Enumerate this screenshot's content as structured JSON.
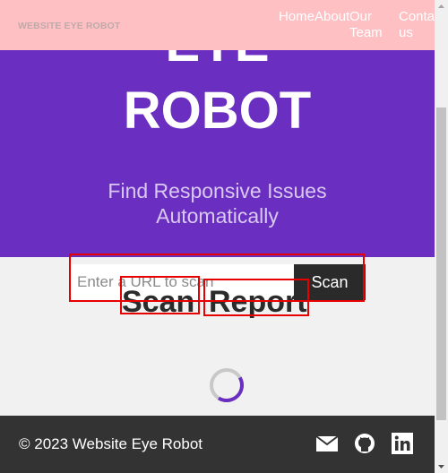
{
  "navbar": {
    "brand": "WEBSITE EYE ROBOT",
    "links": [
      {
        "label": "Home"
      },
      {
        "label": "About"
      },
      {
        "label": "Our Team"
      },
      {
        "label": "Contact us"
      }
    ]
  },
  "hero": {
    "title_line1": "EYE",
    "title_line2": "ROBOT",
    "subtitle": "Find Responsive Issues Automatically"
  },
  "scan": {
    "placeholder": "Enter a URL to scan",
    "button_label": "Scan"
  },
  "tabs": [
    {
      "label": "Scan"
    },
    {
      "label": "Report"
    }
  ],
  "footer": {
    "copyright": "© 2023 Website Eye Robot",
    "icons": [
      "mail-icon",
      "github-icon",
      "linkedin-icon"
    ]
  },
  "colors": {
    "navbar": "#ffc0c4",
    "hero": "#6a2fc0",
    "footer": "#333333",
    "highlight": "#e60000",
    "spinner_accent": "#6a2fc0"
  }
}
